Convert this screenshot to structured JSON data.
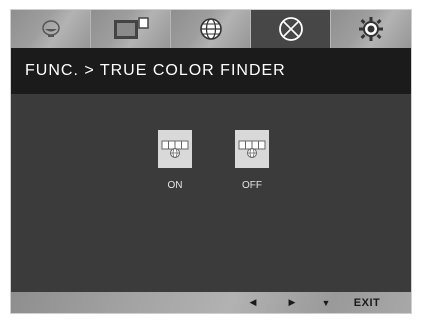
{
  "tabs": [
    {
      "name": "picture-icon",
      "active": false
    },
    {
      "name": "aspect-ratio-icon",
      "active": false
    },
    {
      "name": "globe-icon",
      "active": false
    },
    {
      "name": "function-icon",
      "active": true
    },
    {
      "name": "settings-gear-icon",
      "active": false
    }
  ],
  "header": {
    "title": "FUNC. > TRUE COLOR FINDER"
  },
  "options": [
    {
      "label": "ON",
      "icon": "true-color-finder-icon"
    },
    {
      "label": "OFF",
      "icon": "true-color-finder-icon"
    }
  ],
  "footer": {
    "left_symbol": "◀",
    "right_symbol": "▶",
    "down_symbol": "▼",
    "exit_label": "EXIT"
  },
  "colors": {
    "frame": "#3a3a3a",
    "header": "#1b1b1b",
    "tab_active": "#474747",
    "footer": "#a3a3a3"
  }
}
